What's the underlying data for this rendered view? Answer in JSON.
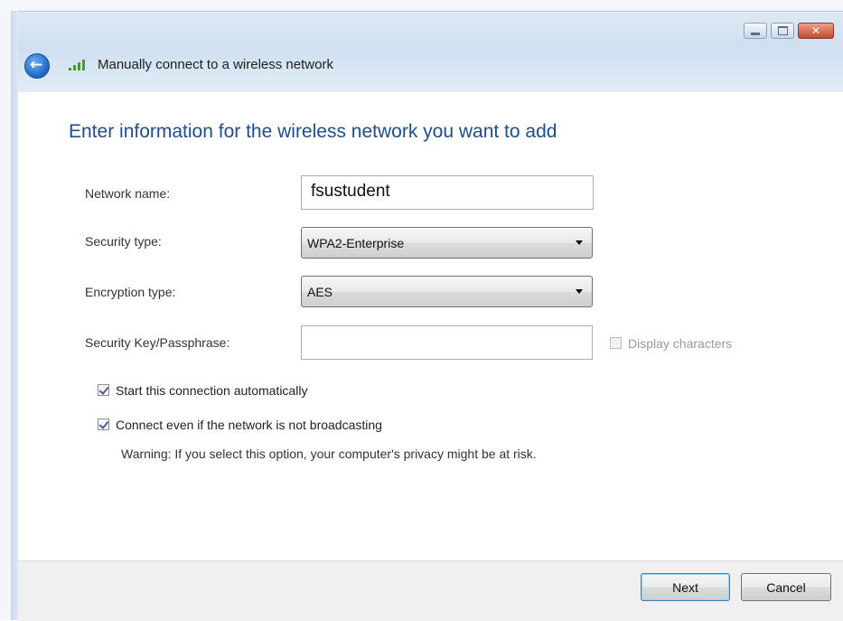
{
  "window": {
    "title": "Manually connect to a wireless network",
    "controls": {
      "minimize": "minimize-icon",
      "maximize": "maximize-icon",
      "close": "✕"
    }
  },
  "page": {
    "heading": "Enter information for the wireless network you want to add"
  },
  "form": {
    "network_name": {
      "label": "Network name:",
      "value": "fsustudent"
    },
    "security_type": {
      "label": "Security type:",
      "value": "WPA2-Enterprise"
    },
    "encryption_type": {
      "label": "Encryption type:",
      "value": "AES"
    },
    "security_key": {
      "label": "Security Key/Passphrase:",
      "value": ""
    },
    "display_characters": {
      "label": "Display characters",
      "checked": false,
      "disabled": true
    },
    "start_automatically": {
      "label": "Start this connection automatically",
      "checked": true
    },
    "connect_not_broadcasting": {
      "label": "Connect even if the network is not broadcasting",
      "checked": true
    },
    "warning": "Warning: If you select this option, your computer's privacy might be at risk."
  },
  "footer": {
    "next_label": "Next",
    "cancel_label": "Cancel"
  },
  "colors": {
    "heading": "#1f4e8c",
    "back_button": "#1e63c4",
    "signal_icon": "#3f9e2e"
  }
}
